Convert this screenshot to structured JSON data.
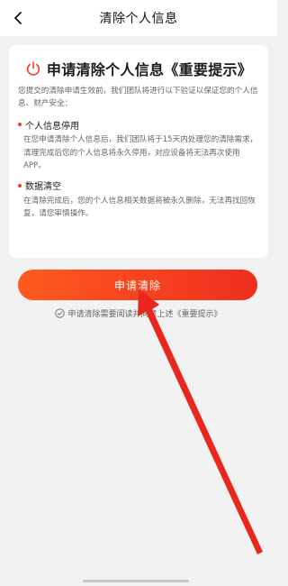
{
  "header": {
    "title": "清除个人信息"
  },
  "card": {
    "title": "申请清除个人信息《重要提示》",
    "intro": "您提交的清除申请生效前，我们团队将进行以下验证以保证您的个人信息、财产安全：",
    "sections": [
      {
        "heading": "个人信息停用",
        "body": "在您申请清除个人信息后，我们团队将于15天内处理您的清除需求，清理完成后您的个人信息将永久停用，对应设备将无法再次使用APP。"
      },
      {
        "heading": "数据清空",
        "body": "在清除完成后，您的个人信息相关数据将被永久删除，无法再找回恢复，请您审慎操作。"
      }
    ]
  },
  "apply_button": {
    "label": "申请清除"
  },
  "agreement": {
    "text": "申请清除需要阅读并同意上述《重要提示》"
  },
  "icons": {
    "back": "chevron-left-icon",
    "power": "power-icon",
    "check": "check-circle-icon"
  },
  "colors": {
    "accent": "#ee3b2a",
    "button_start": "#ff5a1f",
    "button_end": "#ee2e1f",
    "annotation_arrow": "#e8281e"
  }
}
